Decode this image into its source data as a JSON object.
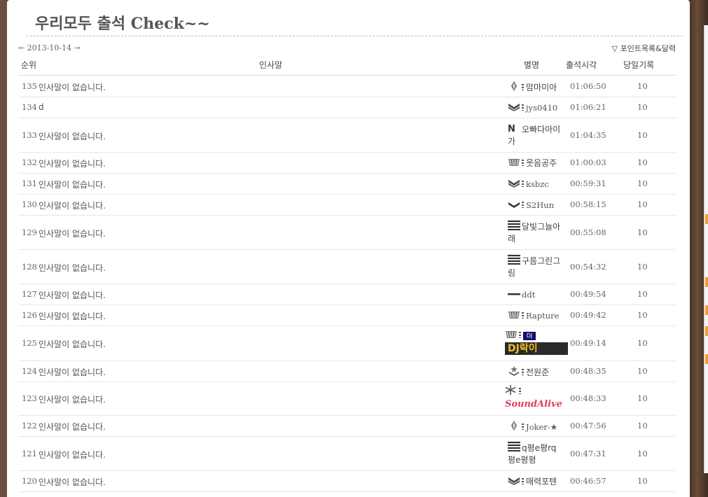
{
  "title": "우리모두 출석 Check~~",
  "date_nav": {
    "prev_arrow": "←",
    "date": "2013-10-14",
    "next_arrow": "→"
  },
  "point_link": "▽ 포인트목록&달력",
  "columns": {
    "rank": "순위",
    "greeting": "인사말",
    "nickname": "별명",
    "time": "출석시각",
    "record": "당일기록"
  },
  "rows": [
    {
      "rank": "135",
      "msg": "인사말이 없습니다.",
      "nick": "맘마미아",
      "time": "01:06:50",
      "rec": "10",
      "icon": "diamond-level-icon"
    },
    {
      "rank": "134",
      "msg": "d",
      "nick": "jys0410",
      "time": "01:06:21",
      "rec": "10",
      "icon": "double-chevron-level-icon"
    },
    {
      "rank": "133",
      "msg": "인사말이 없습니다.",
      "nick": "오빠다아이가",
      "time": "01:04:35",
      "rec": "10",
      "icon": "new-badge-icon"
    },
    {
      "rank": "132",
      "msg": "인사말이 없습니다.",
      "nick": "웃음공주",
      "time": "01:00:03",
      "rec": "10",
      "icon": "wing-level-icon"
    },
    {
      "rank": "131",
      "msg": "인사말이 없습니다.",
      "nick": "ksbzc",
      "time": "00:59:31",
      "rec": "10",
      "icon": "double-chevron-level-icon"
    },
    {
      "rank": "130",
      "msg": "인사말이 없습니다.",
      "nick": "S2Hun",
      "time": "00:58:15",
      "rec": "10",
      "icon": "chevron-level-icon"
    },
    {
      "rank": "129",
      "msg": "인사말이 없습니다.",
      "nick": "달빛그늘아래",
      "time": "00:55:08",
      "rec": "10",
      "icon": "four-bar-level-icon"
    },
    {
      "rank": "128",
      "msg": "인사말이 없습니다.",
      "nick": "구름그린그림",
      "time": "00:54:32",
      "rec": "10",
      "icon": "four-bar-level-icon"
    },
    {
      "rank": "127",
      "msg": "인사말이 없습니다.",
      "nick": "ddt",
      "time": "00:49:54",
      "rec": "10",
      "icon": "single-bar-level-icon"
    },
    {
      "rank": "126",
      "msg": "인사말이 없습니다.",
      "nick": "Rapture",
      "time": "00:49:42",
      "rec": "10",
      "icon": "wing-level-icon"
    },
    {
      "rank": "125",
      "msg": "인사말이 없습니다.",
      "nick": "DJ락이",
      "time": "00:49:14",
      "rec": "10",
      "icon": "wing-level-icon"
    },
    {
      "rank": "124",
      "msg": "인사말이 없습니다.",
      "nick": "전원준",
      "time": "00:48:35",
      "rec": "10",
      "icon": "star-chevron-level-icon"
    },
    {
      "rank": "123",
      "msg": "인사말이 없습니다.",
      "nick": "SoundAlive",
      "time": "00:48:33",
      "rec": "10",
      "icon": "snowflake-level-icon"
    },
    {
      "rank": "122",
      "msg": "인사말이 없습니다.",
      "nick": "Joker-★",
      "time": "00:47:56",
      "rec": "10",
      "icon": "diamond-level-icon"
    },
    {
      "rank": "121",
      "msg": "인사말이 없습니다.",
      "nick": "q평e평rq평e평평",
      "time": "00:47:31",
      "rec": "10",
      "icon": "four-bar-level-icon"
    },
    {
      "rank": "120",
      "msg": "인사말이 없습니다.",
      "nick": "매력포텐",
      "time": "00:46:57",
      "rec": "10",
      "icon": "double-chevron-level-icon"
    }
  ],
  "dj_mini_label": "DJ",
  "colors": {
    "title": "#555555",
    "row_border": "#e6e6e6",
    "background": "#5a4030"
  }
}
